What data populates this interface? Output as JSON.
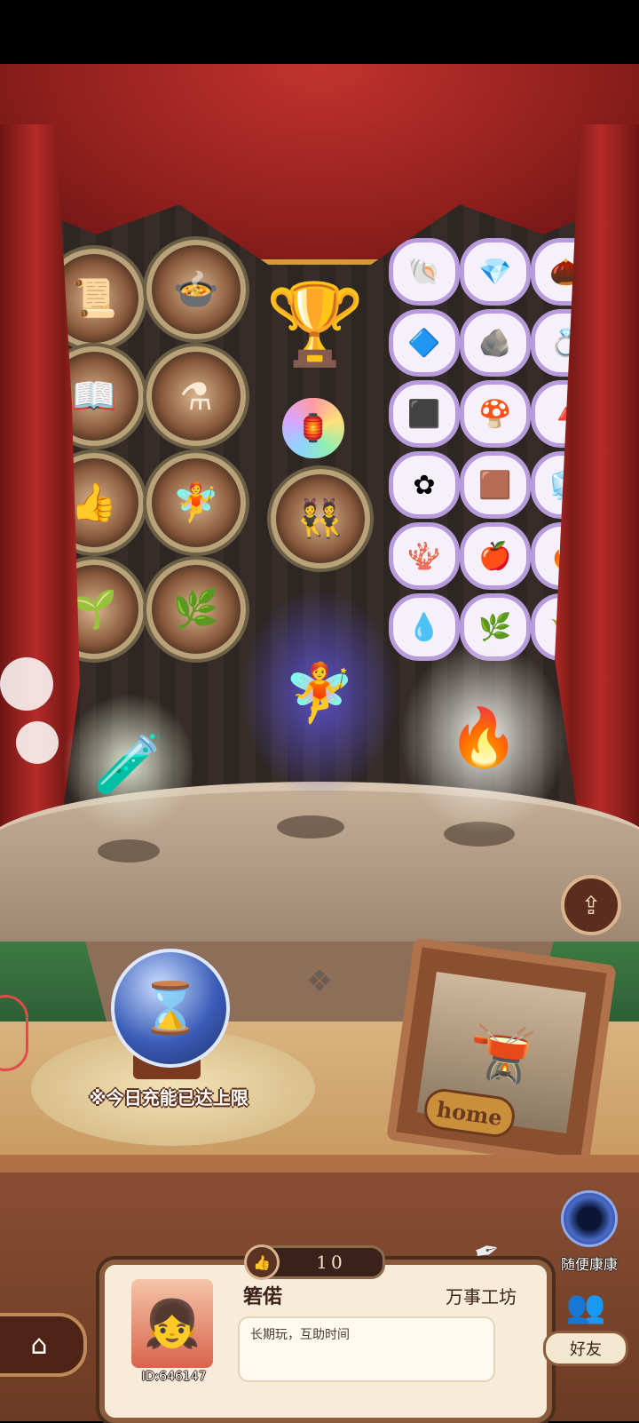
{
  "badges_left": [
    {
      "icon": "book-scroll-icon",
      "glyph": "📜"
    },
    {
      "icon": "cauldron-icon",
      "glyph": "🍲"
    },
    {
      "icon": "book-icon",
      "glyph": "📖"
    },
    {
      "icon": "cauldron-sparkle-icon",
      "glyph": "⚗"
    },
    {
      "icon": "thumbs-up-icon",
      "glyph": "👍"
    },
    {
      "icon": "fairy-icon",
      "glyph": "🧚"
    },
    {
      "icon": "two-fairies-icon",
      "glyph": "👯"
    },
    {
      "icon": "sprout-icon",
      "glyph": "🌱"
    },
    {
      "icon": "leaf-ornament-icon",
      "glyph": "🌿"
    }
  ],
  "items": [
    {
      "icon": "shell-icon",
      "glyph": "🐚"
    },
    {
      "icon": "red-crystal-icon",
      "glyph": "💎"
    },
    {
      "icon": "nut-icon",
      "glyph": "🌰"
    },
    {
      "icon": "white-crystal-icon",
      "glyph": "🔷"
    },
    {
      "icon": "metal-ore-icon",
      "glyph": "🪨"
    },
    {
      "icon": "gem-ring-icon",
      "glyph": "💍"
    },
    {
      "icon": "coal-icon",
      "glyph": "⬛"
    },
    {
      "icon": "rainbow-mushroom-icon",
      "glyph": "🍄"
    },
    {
      "icon": "black-shard-icon",
      "glyph": "🔺"
    },
    {
      "icon": "blue-flower-icon",
      "glyph": "✿"
    },
    {
      "icon": "wood-block-icon",
      "glyph": "🟫"
    },
    {
      "icon": "ice-mound-icon",
      "glyph": "🧊"
    },
    {
      "icon": "purple-coral-icon",
      "glyph": "🪸"
    },
    {
      "icon": "red-apple-icon",
      "glyph": "🍎"
    },
    {
      "icon": "fire-ore-icon",
      "glyph": "🔥"
    },
    {
      "icon": "blue-jelly-icon",
      "glyph": "💧"
    },
    {
      "icon": "green-herb-icon",
      "glyph": "🌿"
    },
    {
      "icon": "golden-wheat-icon",
      "glyph": "🌾"
    }
  ],
  "trophy": {
    "icon": "winged-trophy-icon",
    "glyph": "🏆"
  },
  "lantern": {
    "icon": "rainbow-lantern-icon",
    "glyph": "🏮"
  },
  "characters": [
    {
      "name": "scientist-fairy",
      "glyph": "🧪"
    },
    {
      "name": "blue-hair-fairy",
      "glyph": "🧚"
    },
    {
      "name": "white-hair-fairy",
      "glyph": "🔥"
    }
  ],
  "hourglass": {
    "icon": "hourglass-icon",
    "glyph": "⌛",
    "status_text": "※今日充能已达上限"
  },
  "home_frame": {
    "label": "home",
    "glyph": "🫕"
  },
  "share": {
    "icon": "share-icon",
    "glyph": "⇪"
  },
  "random_visit": {
    "label": "随便康康"
  },
  "likes": {
    "count": "10",
    "glyph": "👍"
  },
  "profile": {
    "name": "箬偌",
    "workshop": "万事工坊",
    "bio": "长期玩，互助时间",
    "id": "ID:646147",
    "avatar_glyph": "👧"
  },
  "nav": {
    "home_glyph": "⌂",
    "friends_label": "好友",
    "friends_glyph": "👥"
  }
}
